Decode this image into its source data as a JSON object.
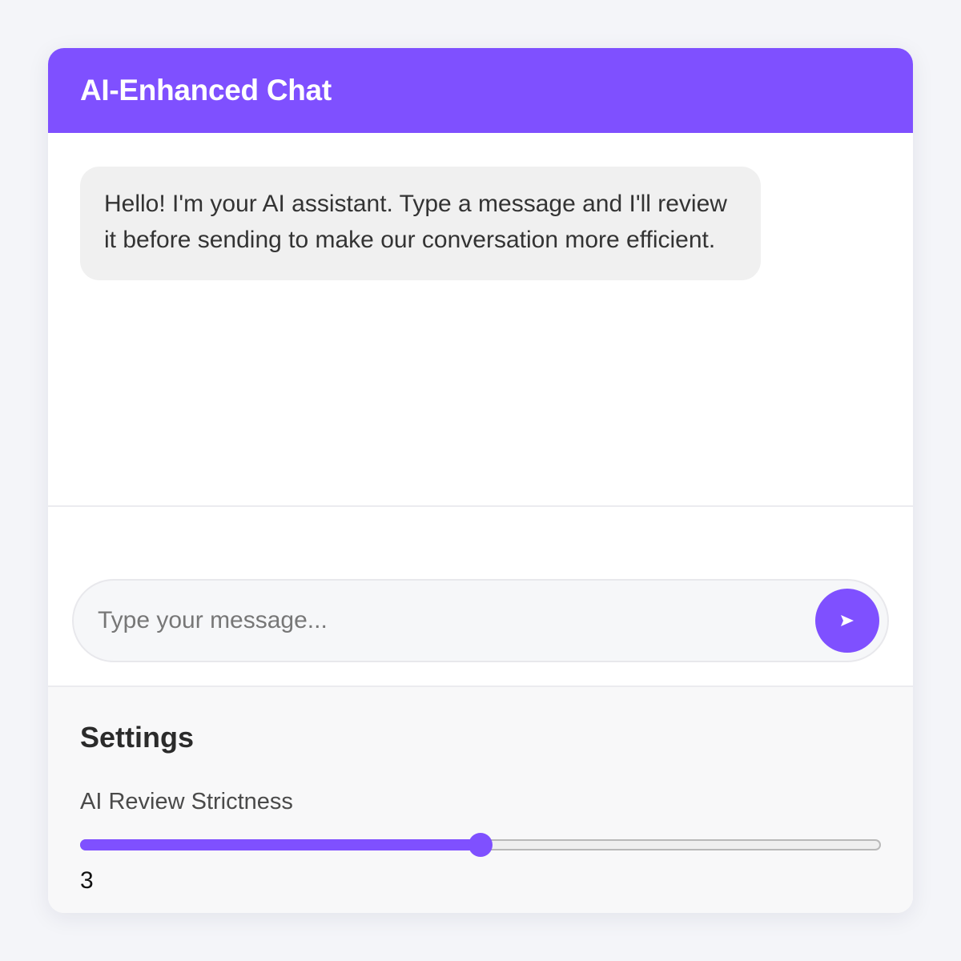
{
  "header": {
    "title": "AI-Enhanced Chat"
  },
  "messages": [
    {
      "sender": "assistant",
      "text": "Hello! I'm your AI assistant. Type a message and I'll review it before sending to make our conversation more efficient."
    }
  ],
  "compose": {
    "placeholder": "Type your message...",
    "value": "",
    "send_icon": "send-arrow-icon"
  },
  "settings": {
    "title": "Settings",
    "strictness_label": "AI Review Strictness",
    "strictness_value": "3",
    "strictness_min": 1,
    "strictness_max": 5
  },
  "colors": {
    "accent": "#7f50ff",
    "bubble_bg": "#f0f0f0",
    "page_bg": "#f4f5f9"
  }
}
